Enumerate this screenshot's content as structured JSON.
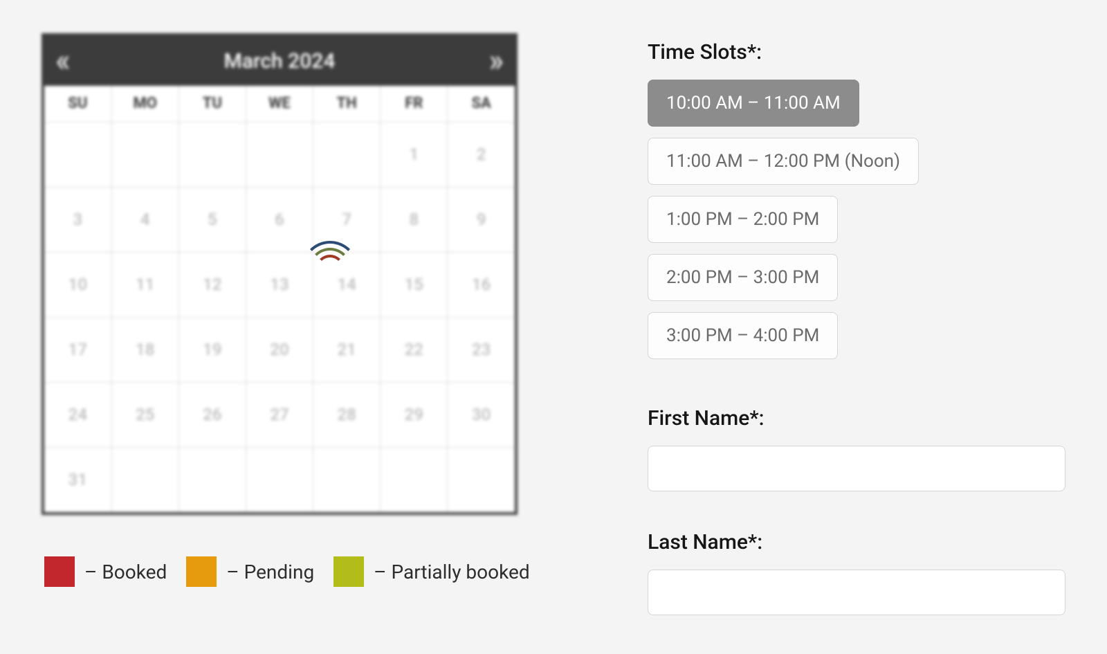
{
  "calendar": {
    "title": "March 2024",
    "prev": "«",
    "next": "»",
    "weekdays": [
      "SU",
      "MO",
      "TU",
      "WE",
      "TH",
      "FR",
      "SA"
    ],
    "weeks": [
      [
        "",
        "",
        "",
        "",
        "",
        "1",
        "2"
      ],
      [
        "3",
        "4",
        "5",
        "6",
        "7",
        "8",
        "9"
      ],
      [
        "10",
        "11",
        "12",
        "13",
        "14",
        "15",
        "16"
      ],
      [
        "17",
        "18",
        "19",
        "20",
        "21",
        "22",
        "23"
      ],
      [
        "24",
        "25",
        "26",
        "27",
        "28",
        "29",
        "30"
      ],
      [
        "31",
        "",
        "",
        "",
        "",
        "",
        ""
      ]
    ]
  },
  "legend": {
    "booked": {
      "label": "– Booked",
      "color": "#c1272d"
    },
    "pending": {
      "label": "– Pending",
      "color": "#e69a0e"
    },
    "partial": {
      "label": "– Partially booked",
      "color": "#b2bd1a"
    }
  },
  "form": {
    "time_slots_label": "Time Slots*:",
    "first_name_label": "First Name*:",
    "last_name_label": "Last Name*:",
    "first_name_value": "",
    "last_name_value": ""
  },
  "slots": [
    {
      "label": "10:00 AM – 11:00 AM",
      "selected": true
    },
    {
      "label": "11:00 AM – 12:00 PM (Noon)",
      "selected": false
    },
    {
      "label": "1:00 PM – 2:00 PM",
      "selected": false
    },
    {
      "label": "2:00 PM – 3:00 PM",
      "selected": false
    },
    {
      "label": "3:00 PM – 4:00 PM",
      "selected": false
    }
  ],
  "colors": {
    "accent_selected_bg": "#8c8c8c"
  }
}
